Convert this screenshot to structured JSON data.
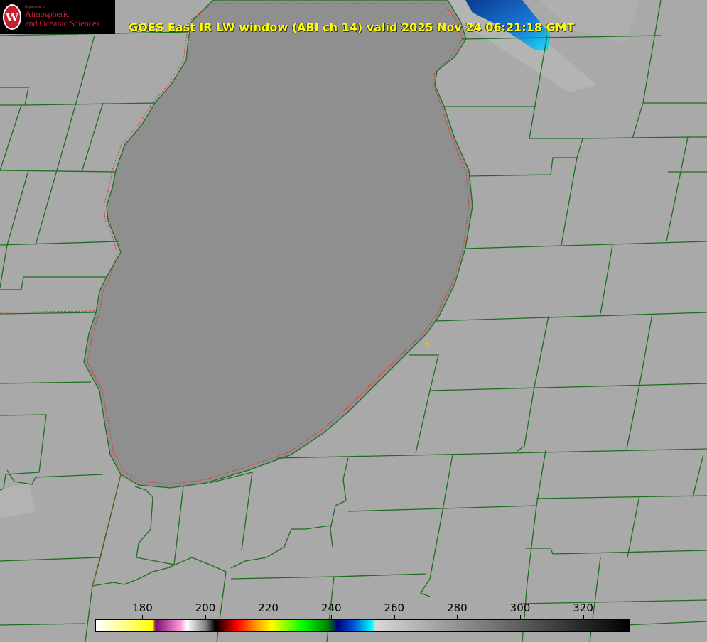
{
  "logo": {
    "department": "Department of",
    "line1": "Atmospheric",
    "line2": "and Oceanic Sciences",
    "seal_letter": "W"
  },
  "title": "GOES East IR LW window (ABI ch 14) valid 2025 Nov 24 06:21:18 GMT",
  "colors": {
    "background": "#a9a9a9",
    "lake": "#8f8f8f",
    "county_lines": "#1e6e1e",
    "shoreline_dotted": "#e0302a",
    "title_text": "#ffff00",
    "cold_cloud": "#0a4fb0"
  },
  "colorbar": {
    "min": 165,
    "max": 335,
    "ticks": [
      "180",
      "200",
      "220",
      "240",
      "260",
      "280",
      "300",
      "320"
    ],
    "tick_values": [
      180,
      200,
      220,
      240,
      260,
      280,
      300,
      320
    ],
    "stops": [
      {
        "v": 165,
        "c": "#ffffff"
      },
      {
        "v": 175,
        "c": "#ffff80"
      },
      {
        "v": 183,
        "c": "#ffff00"
      },
      {
        "v": 184,
        "c": "#7a1070"
      },
      {
        "v": 192,
        "c": "#ff9ad8"
      },
      {
        "v": 194,
        "c": "#ffffff"
      },
      {
        "v": 200,
        "c": "#808080"
      },
      {
        "v": 203,
        "c": "#000000"
      },
      {
        "v": 210,
        "c": "#ff0000"
      },
      {
        "v": 216,
        "c": "#ff9900"
      },
      {
        "v": 221,
        "c": "#ffff00"
      },
      {
        "v": 231,
        "c": "#00ff00"
      },
      {
        "v": 239,
        "c": "#008000"
      },
      {
        "v": 242,
        "c": "#000080"
      },
      {
        "v": 247,
        "c": "#0050d0"
      },
      {
        "v": 253,
        "c": "#00ffff"
      },
      {
        "v": 254,
        "c": "#d8d8d8"
      },
      {
        "v": 335,
        "c": "#000000"
      }
    ]
  }
}
